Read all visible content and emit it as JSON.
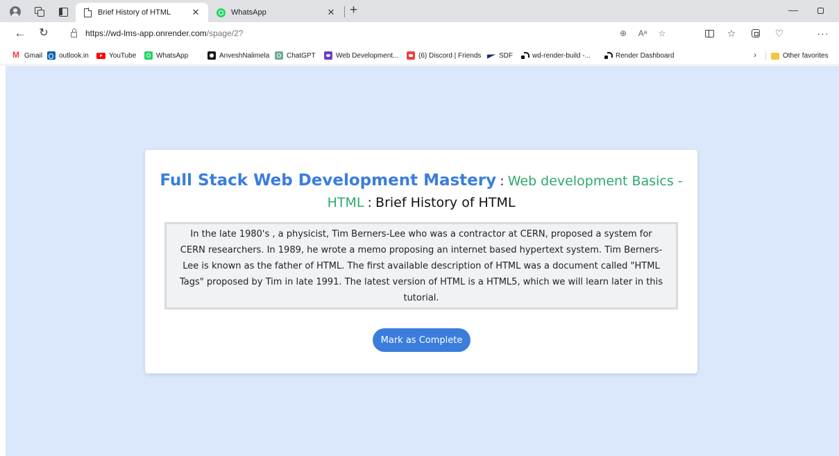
{
  "browser": {
    "tabs": [
      {
        "title": "Brief History of HTML",
        "icon": "document-icon",
        "active": true
      },
      {
        "title": "WhatsApp",
        "icon": "whatsapp-icon",
        "active": false
      }
    ],
    "url_host": "https://wd-lms-app.onrender.com",
    "url_path": "/spage/2?",
    "bookmarks": [
      {
        "label": "Gmail",
        "icon": "gmail-icon"
      },
      {
        "label": "outlook.in",
        "icon": "outlook-icon"
      },
      {
        "label": "YouTube",
        "icon": "youtube-icon"
      },
      {
        "label": "WhatsApp",
        "icon": "whatsapp-icon"
      },
      {
        "label": "AnveshNalimela",
        "icon": "github-icon"
      },
      {
        "label": "ChatGPT",
        "icon": "chatgpt-icon"
      },
      {
        "label": "Web Development...",
        "icon": "webdev-icon"
      },
      {
        "label": "(6) Discord | Friends",
        "icon": "discord-icon"
      },
      {
        "label": "SDF",
        "icon": "sdf-icon"
      },
      {
        "label": "wd-render-build -...",
        "icon": "render-icon"
      },
      {
        "label": "Render Dashboard",
        "icon": "render-icon"
      }
    ],
    "other_favorites": "Other favorites"
  },
  "page": {
    "course_title": "Full Stack Web Development Mastery",
    "separator": ":",
    "module_title": "Web development Basics - HTML",
    "topic_title": "Brief History of HTML",
    "description": "In the late 1980's , a physicist, Tim Berners-Lee who was a contractor at CERN, proposed a system for CERN researchers. In 1989, he wrote a memo proposing an internet based hypertext system. Tim Berners-Lee is known as the father of HTML. The first available description of HTML was a document called \"HTML Tags\" proposed by Tim in late 1991. The latest version of HTML is a HTML5, which we will learn later in this tutorial.",
    "complete_button": "Mark as Complete"
  },
  "colors": {
    "page_background": "#dbe7fa",
    "course_title": "#3b7ddd",
    "module_title": "#2ea86b",
    "button": "#3b7ddd",
    "description_box": "#f1f2f4"
  }
}
